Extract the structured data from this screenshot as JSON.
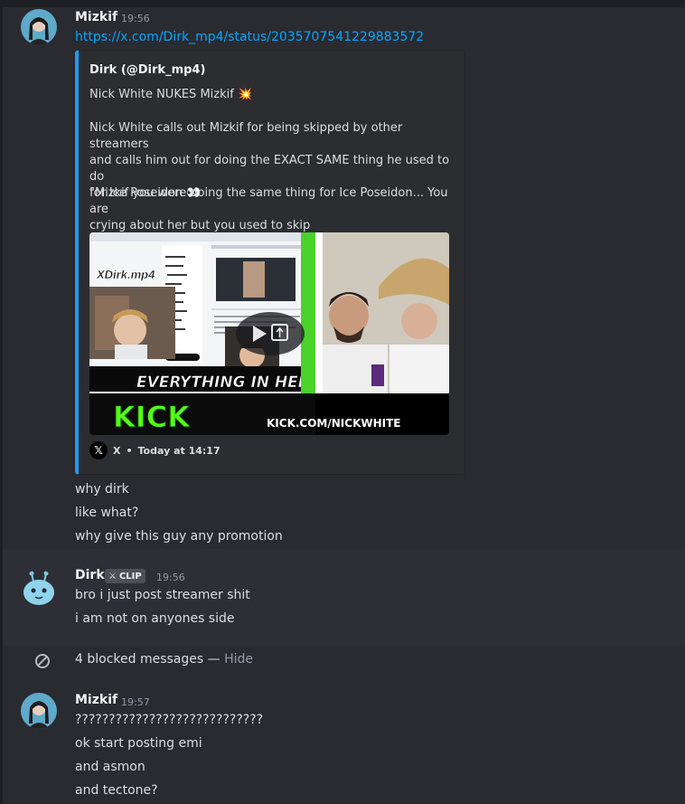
{
  "messages": [
    {
      "author": "Mizkif",
      "time": "19:56",
      "link": "https://x.com/Dirk_mp4/status/2035707541229883572",
      "embed": {
        "author": "Dirk (@Dirk_mp4)",
        "title": "Nick White NUKES Mizkif",
        "title_emoji": "💥",
        "desc_line1": "Nick White calls out Mizkif for being skipped by other streamers",
        "desc_line2": "and calls him out for doing the EXACT SAME thing he used to do",
        "desc_line3": "for Ice Poseidon",
        "desc_line3_emoji": "👀",
        "quote_line1": "\"Mizkif you were doing the same thing for Ice Poseidon... You are",
        "quote_line2": "crying about her but you used to skip",
        "media": {
          "watermark": "XDirk.mp4",
          "caption": "EVERYTHING IN HER",
          "brand": "KICK",
          "url": "KICK.COM/NICKWHITE"
        },
        "footer_source": "X",
        "footer_time": "Today at 14:17"
      },
      "followups": [
        "why dirk",
        "like what?",
        "why give this guy any promotion"
      ]
    },
    {
      "author": "Dirk",
      "badge": "CLIP",
      "time": "19:56",
      "lines": [
        "bro i just post streamer shit",
        "i am not on anyones side"
      ]
    },
    {
      "blocked_count_text": "4 blocked messages",
      "separator": "—",
      "hide_label": "Hide"
    },
    {
      "author": "Mizkif",
      "time": "19:57",
      "lines": [
        "????????????????????????????",
        "ok start posting emi",
        "and asmon",
        "and tectone?"
      ]
    }
  ],
  "colors": {
    "background": "#2a2a31",
    "highlight_band": "#2e2f36",
    "embed_accent": "#1d9bf0",
    "link": "#00a8fc",
    "kick_green": "#53fc18"
  }
}
